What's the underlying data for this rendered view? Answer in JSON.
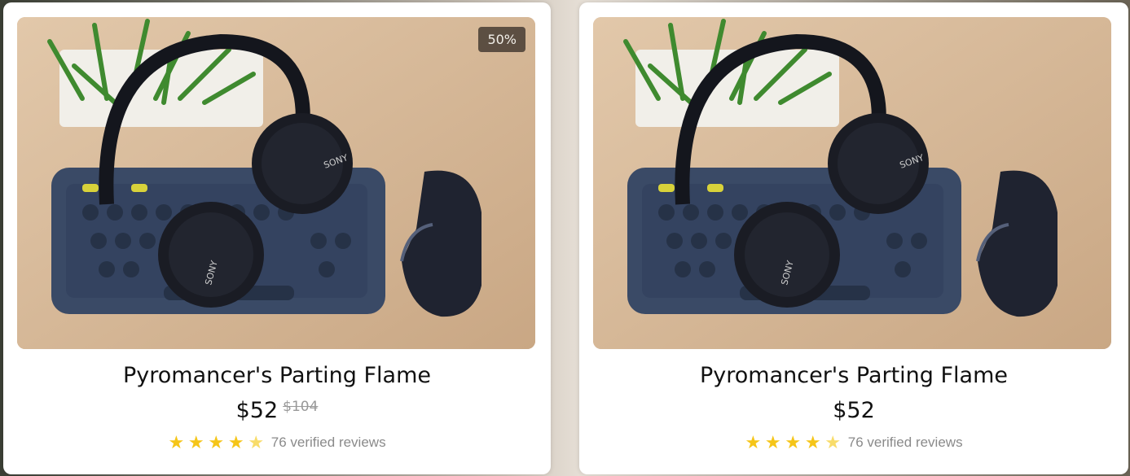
{
  "colors": {
    "star": "#f5c518",
    "star_half": "#f8dc6a",
    "badge_bg": "#463c32",
    "photo_bg": "#d6b99a"
  },
  "products": [
    {
      "image_icon": "headphones-keyboard-mouse-photo",
      "badge": "50%",
      "title": "Pyromancer's Parting Flame",
      "price": "$52",
      "old_price": "$104",
      "rating": 4.5,
      "reviews_text": "76 verified reviews"
    },
    {
      "image_icon": "headphones-keyboard-mouse-photo",
      "title": "Pyromancer's Parting Flame",
      "price": "$52",
      "rating": 4.5,
      "reviews_text": "76 verified reviews"
    }
  ]
}
